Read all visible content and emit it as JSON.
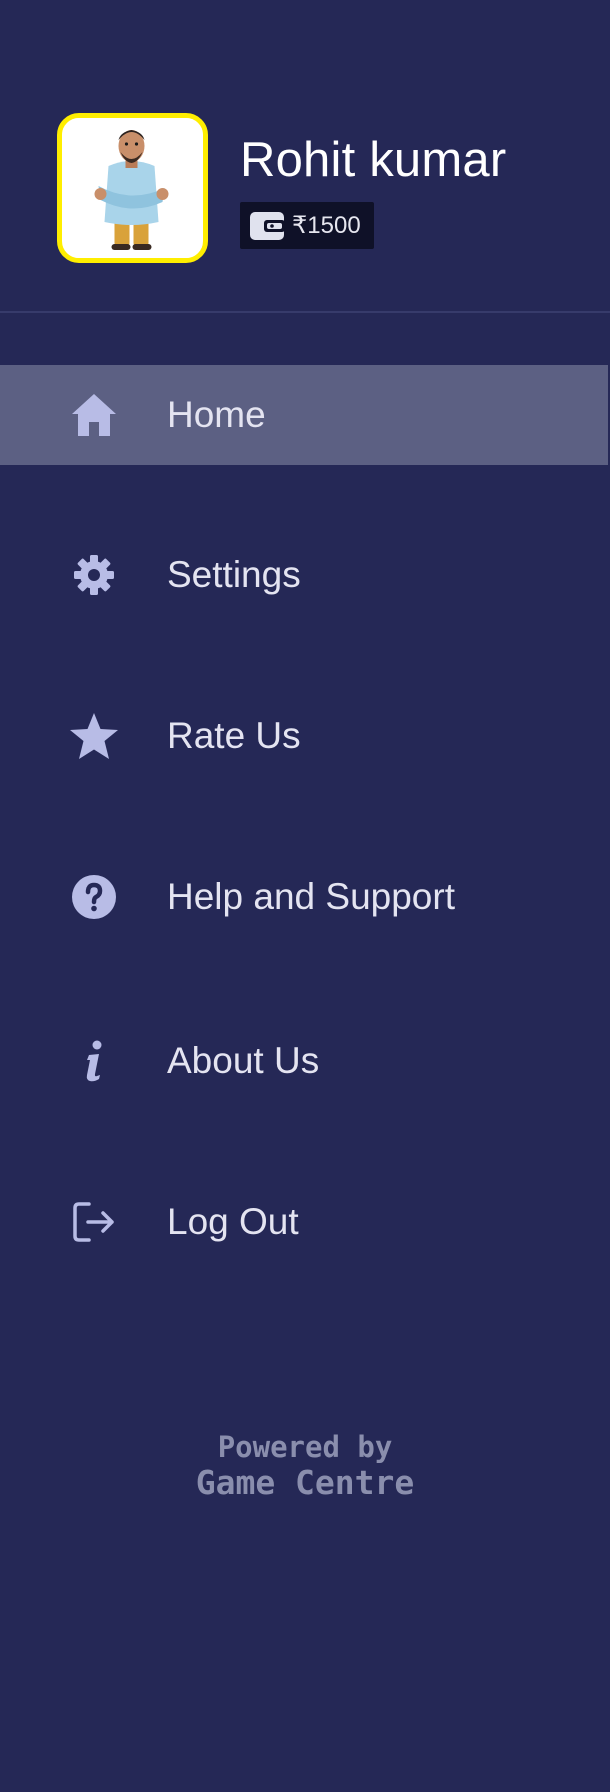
{
  "profile": {
    "name": "Rohit kumar",
    "wallet_amount": "₹1500",
    "avatar_border_color": "#ffee00",
    "avatar_icon": "person-avatar-icon",
    "wallet_icon": "wallet-icon"
  },
  "menu": {
    "items": [
      {
        "label": "Home",
        "icon": "home-icon",
        "active": true
      },
      {
        "label": "Settings",
        "icon": "gear-icon",
        "active": false
      },
      {
        "label": "Rate Us",
        "icon": "star-icon",
        "active": false
      },
      {
        "label": "Help and Support",
        "icon": "help-icon",
        "active": false
      },
      {
        "label": "About Us",
        "icon": "info-icon",
        "active": false
      },
      {
        "label": "Log Out",
        "icon": "logout-icon",
        "active": false
      }
    ]
  },
  "footer": {
    "powered_by": "Powered by",
    "brand": "Game Centre"
  },
  "colors": {
    "background": "#252856",
    "active_item": "#5c6083",
    "icon": "#b8bce6",
    "label": "#e4e4f1",
    "footer_text": "#8a8ead"
  }
}
